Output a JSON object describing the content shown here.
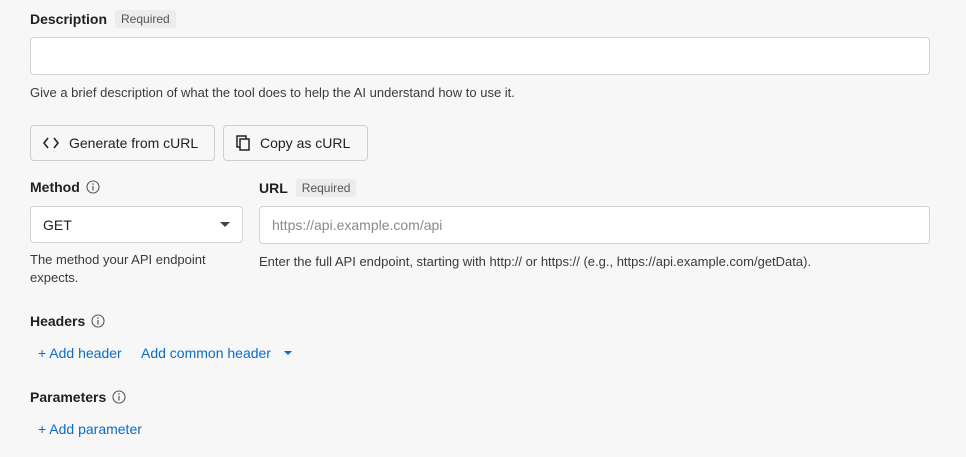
{
  "description": {
    "label": "Description",
    "required_badge": "Required",
    "value": "",
    "placeholder": "",
    "helper": "Give a brief description of what the tool does to help the AI understand how to use it."
  },
  "actions": {
    "generate_label": "Generate from cURL",
    "copy_label": "Copy as cURL"
  },
  "method": {
    "label": "Method",
    "selected": "GET",
    "helper": "The method your API endpoint expects."
  },
  "url": {
    "label": "URL",
    "required_badge": "Required",
    "value": "",
    "placeholder": "https://api.example.com/api",
    "helper": "Enter the full API endpoint, starting with http:// or https:// (e.g., https://api.example.com/getData)."
  },
  "headers": {
    "label": "Headers",
    "add_header": "+ Add header",
    "add_common_header": "Add common header"
  },
  "parameters": {
    "label": "Parameters",
    "add_parameter": "+ Add parameter"
  },
  "colors": {
    "link": "#0b6bcb",
    "background": "#f7f7f7",
    "border": "#d3d3d3"
  },
  "icons": {
    "code": "code-icon",
    "copy": "copy-icon",
    "info": "info-icon",
    "dropdown": "chevron-down-icon"
  }
}
